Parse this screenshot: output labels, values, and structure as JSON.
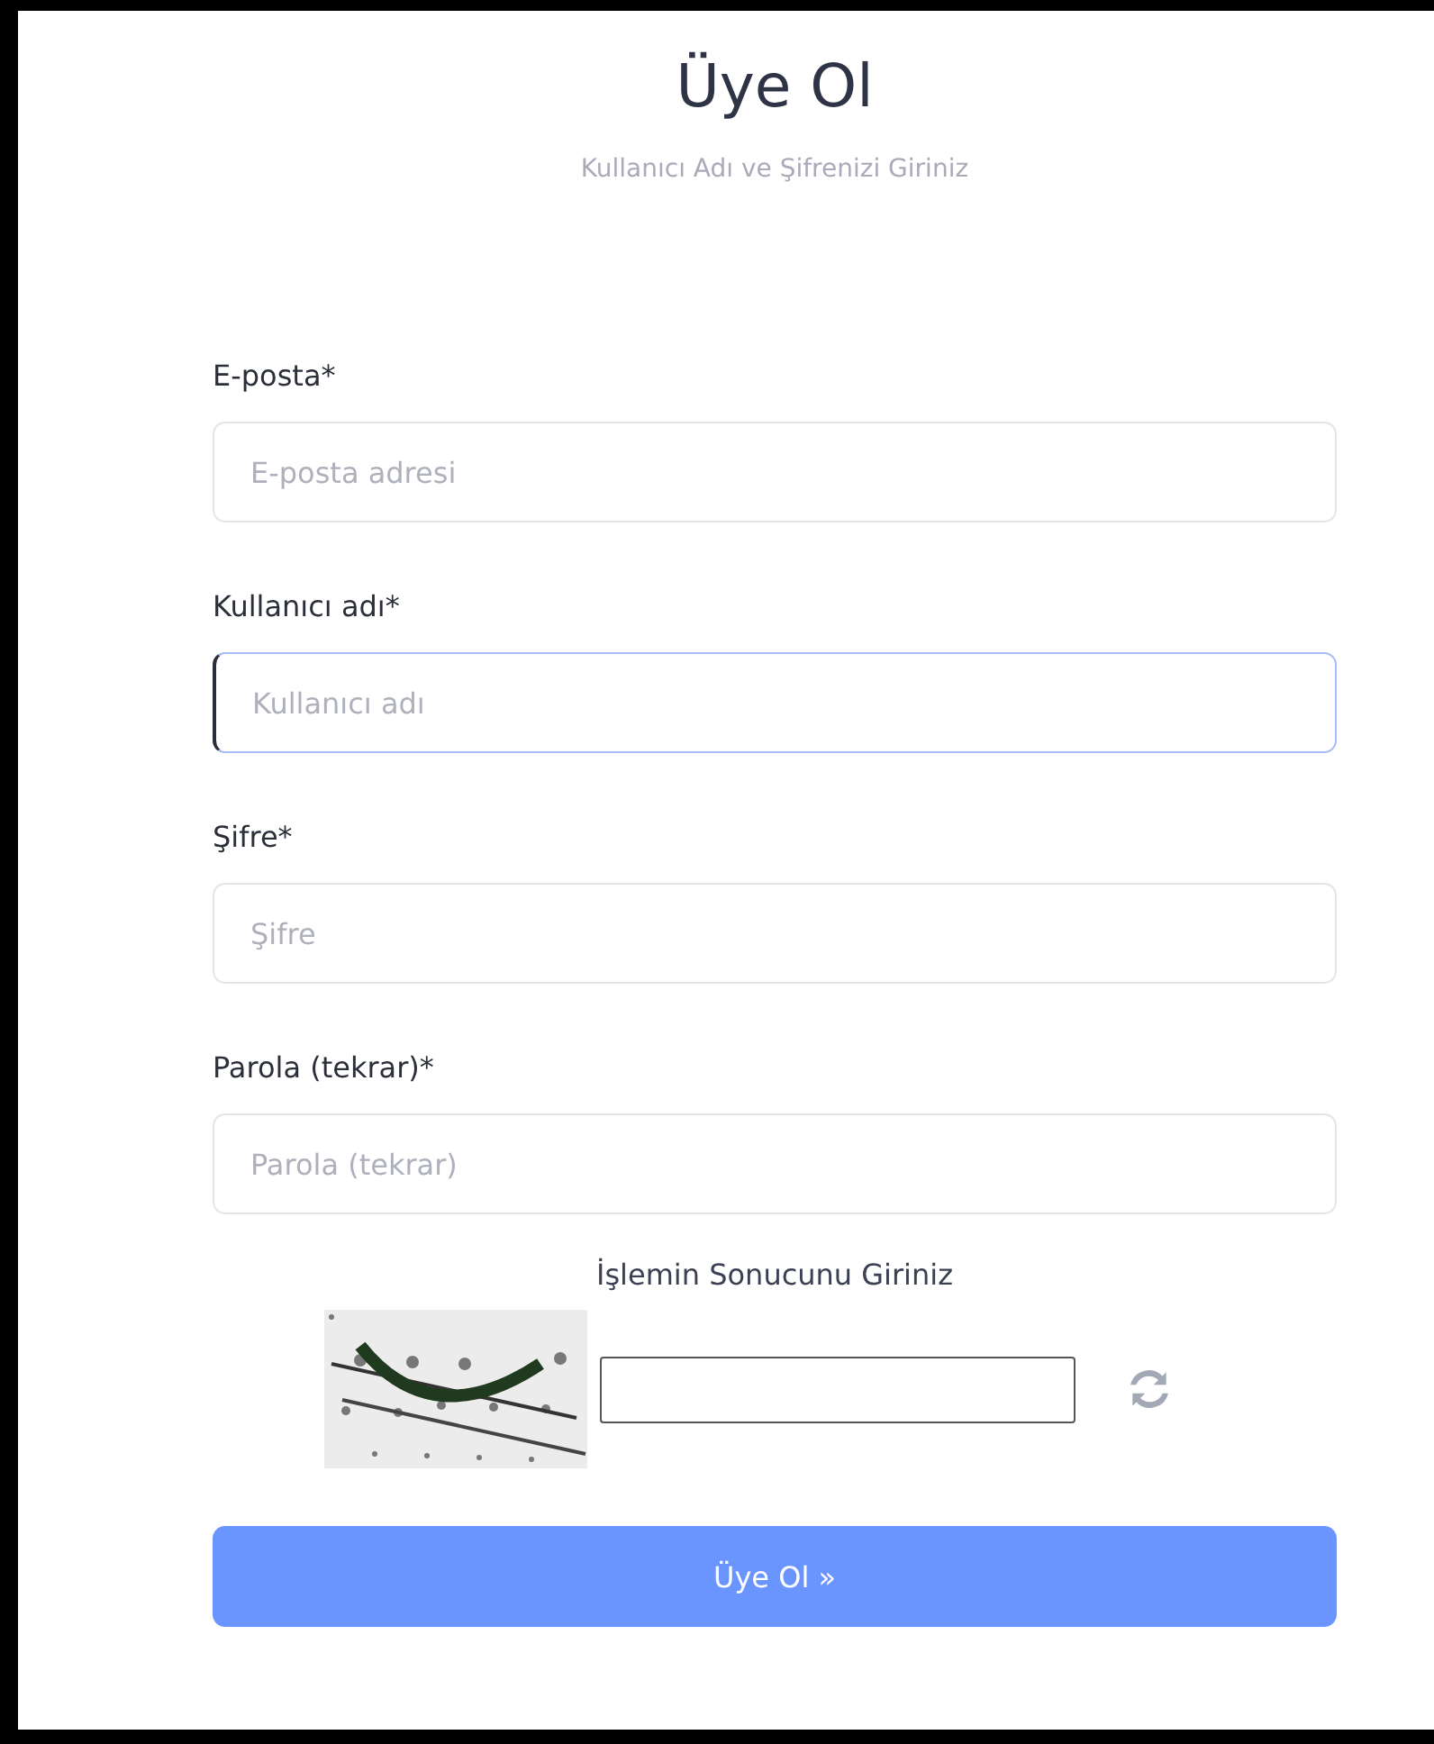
{
  "title": "Üye Ol",
  "subtitle": "Kullanıcı Adı ve Şifrenizi Giriniz",
  "fields": [
    {
      "label": "E-posta*",
      "placeholder": "E-posta adresi",
      "focused": false
    },
    {
      "label": "Kullanıcı adı*",
      "placeholder": "Kullanıcı adı",
      "focused": true
    },
    {
      "label": "Şifre*",
      "placeholder": "Şifre",
      "focused": false
    },
    {
      "label": "Parola (tekrar)*",
      "placeholder": "Parola (tekrar)",
      "focused": false
    }
  ],
  "captcha": {
    "label": "İşlemin Sonucunu Giriniz"
  },
  "submit": "Üye Ol »"
}
